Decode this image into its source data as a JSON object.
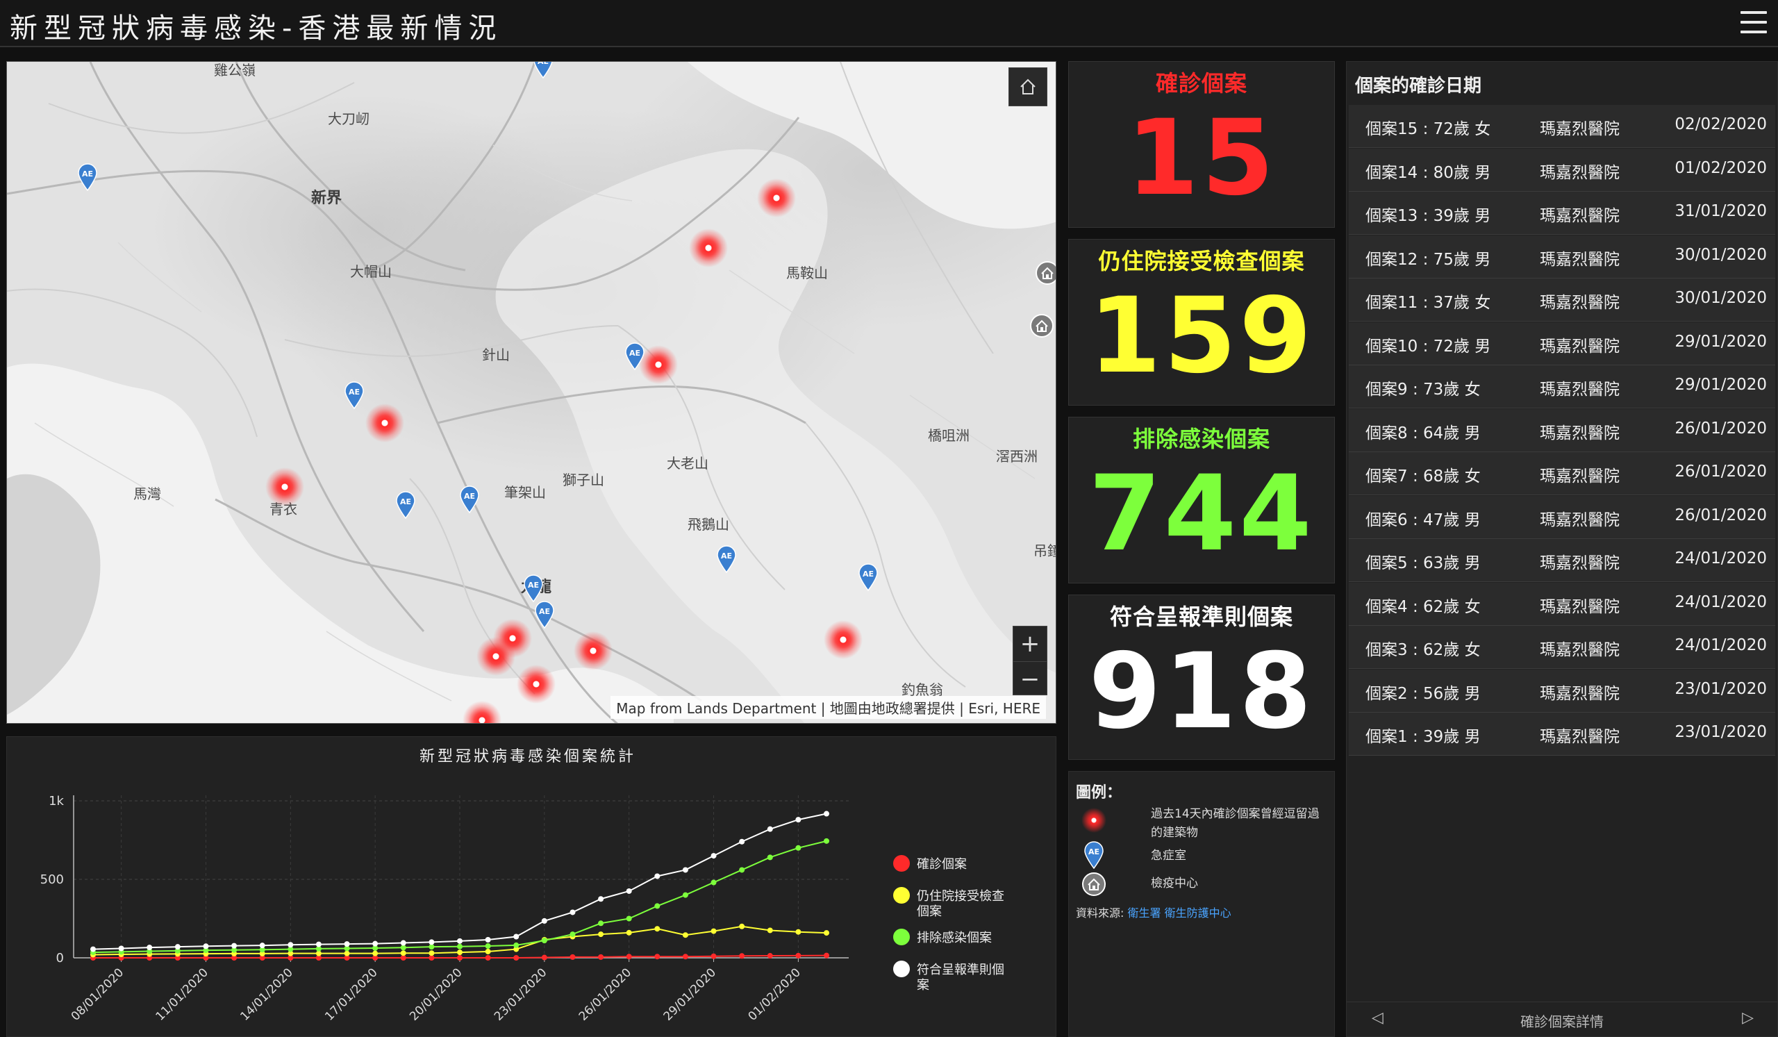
{
  "header": {
    "title": "新型冠狀病毒感染-香港最新情況",
    "menu_icon": "hamburger-menu-icon"
  },
  "map": {
    "places": [
      {
        "name": "大刀屻",
        "big": false
      },
      {
        "name": "新界",
        "big": true
      },
      {
        "name": "大帽山",
        "big": false
      },
      {
        "name": "針山",
        "big": false
      },
      {
        "name": "馬鞍山",
        "big": false
      },
      {
        "name": "大老山",
        "big": false
      },
      {
        "name": "獅子山",
        "big": false
      },
      {
        "name": "筆架山",
        "big": false
      },
      {
        "name": "飛鵝山",
        "big": false
      },
      {
        "name": "馬灣",
        "big": false
      },
      {
        "name": "青衣",
        "big": false
      },
      {
        "name": "九龍",
        "big": true
      },
      {
        "name": "橋咀洲",
        "big": false
      },
      {
        "name": "滘西洲",
        "big": false
      },
      {
        "name": "吊鐘",
        "big": false
      },
      {
        "name": "釣魚翁",
        "big": false
      },
      {
        "name": "雞公嶺",
        "big": false
      }
    ],
    "ae_label": "AE",
    "attribution": "Map from Lands Department | 地圖由地政總署提供 | Esri, HERE",
    "zoom_in": "+",
    "zoom_out": "−"
  },
  "stats": [
    {
      "label": "確診個案",
      "value": "15",
      "color": "#ff2a2a"
    },
    {
      "label": "仍住院接受檢查個案",
      "value": "159",
      "color": "#ffff33"
    },
    {
      "label": "排除感染個案",
      "value": "744",
      "color": "#7dff3c"
    },
    {
      "label": "符合呈報準則個案",
      "value": "918",
      "color": "#ffffff"
    }
  ],
  "legend": {
    "title": "圖例：",
    "items": [
      {
        "icon": "hotspot-icon",
        "text": "過去14天內確診個案曾經逗留過的建築物"
      },
      {
        "icon": "ae-marker-icon",
        "text": "急症室"
      },
      {
        "icon": "quarantine-centre-icon",
        "text": "檢疫中心"
      }
    ],
    "source_label": "資料來源:",
    "source_link": "衛生署 衛生防護中心"
  },
  "cases": {
    "title": "個案的確診日期",
    "rows": [
      {
        "case": "個案15 : 72歲 女",
        "hospital": "瑪嘉烈醫院",
        "date": "02/02/2020"
      },
      {
        "case": "個案14 : 80歲 男",
        "hospital": "瑪嘉烈醫院",
        "date": "01/02/2020"
      },
      {
        "case": "個案13 : 39歲 男",
        "hospital": "瑪嘉烈醫院",
        "date": "31/01/2020"
      },
      {
        "case": "個案12 : 75歲 男",
        "hospital": "瑪嘉烈醫院",
        "date": "30/01/2020"
      },
      {
        "case": "個案11 : 37歲 女",
        "hospital": "瑪嘉烈醫院",
        "date": "30/01/2020"
      },
      {
        "case": "個案10 : 72歲 男",
        "hospital": "瑪嘉烈醫院",
        "date": "29/01/2020"
      },
      {
        "case": "個案9 : 73歲 女",
        "hospital": "瑪嘉烈醫院",
        "date": "29/01/2020"
      },
      {
        "case": "個案8 : 64歲 男",
        "hospital": "瑪嘉烈醫院",
        "date": "26/01/2020"
      },
      {
        "case": "個案7 : 68歲 女",
        "hospital": "瑪嘉烈醫院",
        "date": "26/01/2020"
      },
      {
        "case": "個案6 : 47歲 男",
        "hospital": "瑪嘉烈醫院",
        "date": "26/01/2020"
      },
      {
        "case": "個案5 : 63歲 男",
        "hospital": "瑪嘉烈醫院",
        "date": "24/01/2020"
      },
      {
        "case": "個案4 : 62歲 女",
        "hospital": "瑪嘉烈醫院",
        "date": "24/01/2020"
      },
      {
        "case": "個案3 : 62歲 女",
        "hospital": "瑪嘉烈醫院",
        "date": "24/01/2020"
      },
      {
        "case": "個案2 : 56歲 男",
        "hospital": "瑪嘉烈醫院",
        "date": "23/01/2020"
      },
      {
        "case": "個案1 : 39歲 男",
        "hospital": "瑪嘉烈醫院",
        "date": "23/01/2020"
      }
    ],
    "footer_label": "確診個案詳情",
    "prev": "◁",
    "next": "▷"
  },
  "chart_data": {
    "type": "line",
    "title": "新型冠狀病毒感染個案統計",
    "x": [
      "07/01/2020",
      "08/01/2020",
      "09/01/2020",
      "10/01/2020",
      "11/01/2020",
      "12/01/2020",
      "13/01/2020",
      "14/01/2020",
      "15/01/2020",
      "16/01/2020",
      "17/01/2020",
      "18/01/2020",
      "19/01/2020",
      "20/01/2020",
      "21/01/2020",
      "22/01/2020",
      "23/01/2020",
      "24/01/2020",
      "25/01/2020",
      "26/01/2020",
      "27/01/2020",
      "28/01/2020",
      "29/01/2020",
      "30/01/2020",
      "31/01/2020",
      "01/02/2020",
      "02/02/2020"
    ],
    "xticks": [
      "08/01/2020",
      "11/01/2020",
      "14/01/2020",
      "17/01/2020",
      "20/01/2020",
      "23/01/2020",
      "26/01/2020",
      "29/01/2020",
      "01/02/2020"
    ],
    "yticks": [
      {
        "v": 0,
        "label": "0"
      },
      {
        "v": 500,
        "label": "500"
      },
      {
        "v": 1000,
        "label": "1k"
      }
    ],
    "ylim": [
      0,
      1000
    ],
    "series": [
      {
        "name": "確診個案",
        "color": "#ff2a2a",
        "values": [
          0,
          0,
          0,
          0,
          0,
          0,
          0,
          0,
          0,
          0,
          0,
          0,
          0,
          0,
          0,
          0,
          2,
          5,
          5,
          8,
          8,
          8,
          10,
          12,
          13,
          14,
          15
        ]
      },
      {
        "name": "仍住院接受檢查個案",
        "color": "#ffff33",
        "values": [
          20,
          22,
          24,
          25,
          26,
          27,
          27,
          28,
          28,
          28,
          28,
          30,
          30,
          35,
          40,
          55,
          115,
          135,
          150,
          160,
          185,
          145,
          170,
          200,
          175,
          165,
          159
        ]
      },
      {
        "name": "排除感染個案",
        "color": "#7dff3c",
        "values": [
          35,
          38,
          42,
          45,
          48,
          50,
          52,
          55,
          58,
          60,
          62,
          65,
          70,
          72,
          75,
          80,
          110,
          150,
          220,
          250,
          330,
          400,
          480,
          560,
          640,
          700,
          744
        ]
      },
      {
        "name": "符合呈報準則個案",
        "color": "#ffffff",
        "values": [
          55,
          60,
          66,
          70,
          74,
          77,
          79,
          83,
          86,
          88,
          90,
          95,
          100,
          107,
          115,
          135,
          235,
          290,
          375,
          425,
          520,
          560,
          650,
          740,
          820,
          880,
          918
        ]
      }
    ]
  }
}
